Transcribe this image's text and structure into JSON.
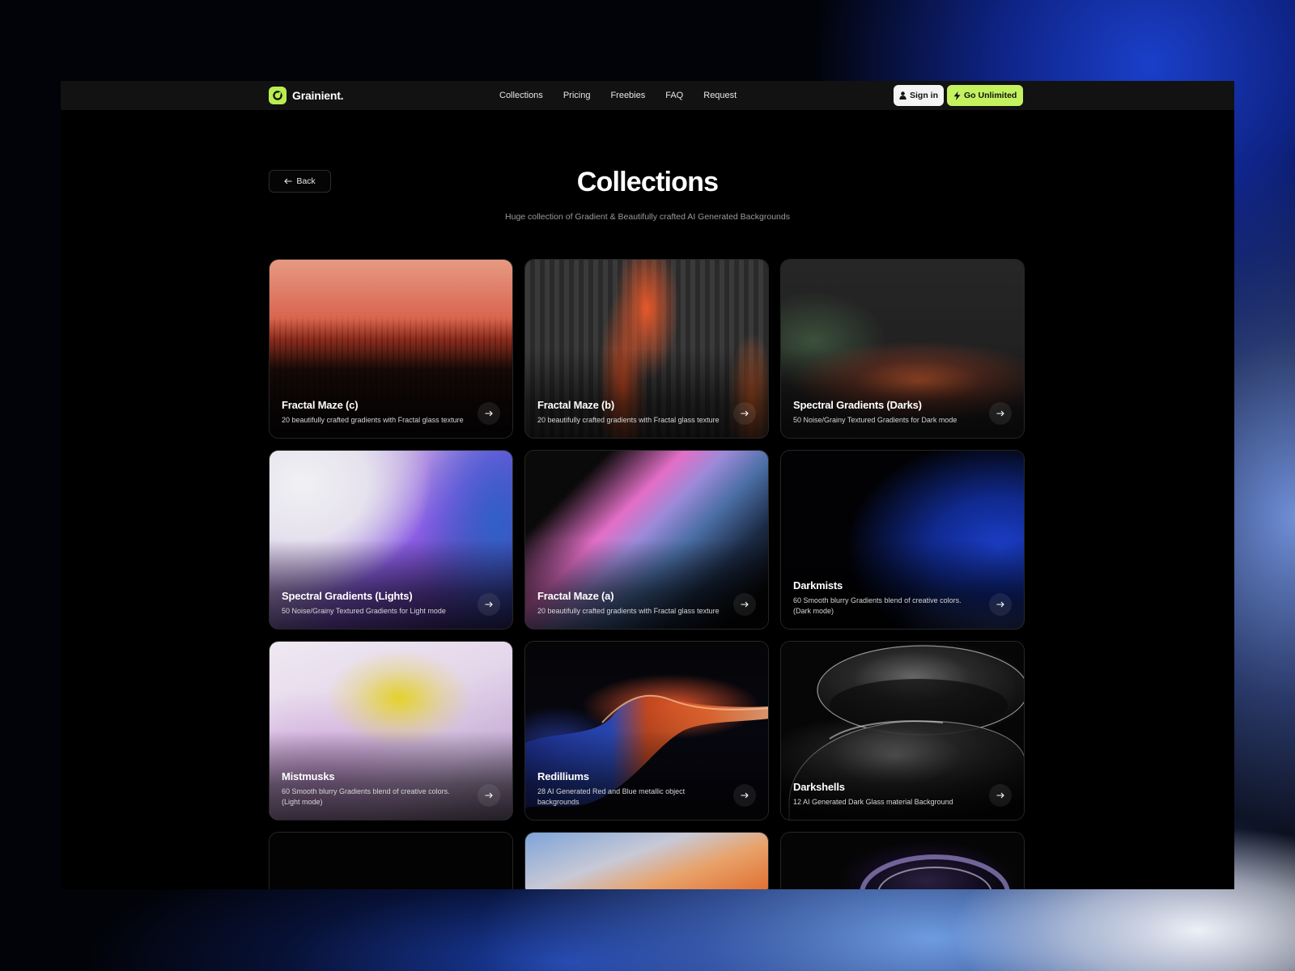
{
  "brand": {
    "name": "Grainient."
  },
  "nav": {
    "links": [
      "Collections",
      "Pricing",
      "Freebies",
      "FAQ",
      "Request"
    ],
    "signin_label": "Sign in",
    "unlimited_label": "Go Unlimited"
  },
  "back_label": "Back",
  "page": {
    "title": "Collections",
    "subtitle": "Huge collection of Gradient & Beautifully crafted AI Generated Backgrounds"
  },
  "cards": [
    {
      "title": "Fractal Maze (c)",
      "desc": "20 beautifully crafted gradients with Fractal glass texture"
    },
    {
      "title": "Fractal Maze (b)",
      "desc": "20 beautifully crafted gradients with Fractal glass texture"
    },
    {
      "title": "Spectral Gradients (Darks)",
      "desc": "50 Noise/Grainy Textured Gradients for Dark mode"
    },
    {
      "title": "Spectral Gradients (Lights)",
      "desc": "50 Noise/Grainy Textured Gradients for Light mode"
    },
    {
      "title": "Fractal Maze (a)",
      "desc": "20 beautifully crafted gradients with Fractal glass texture"
    },
    {
      "title": "Darkmists",
      "desc": "60 Smooth blurry Gradients blend of creative colors. (Dark mode)"
    },
    {
      "title": "Mistmusks",
      "desc": "60 Smooth blurry Gradients blend of creative colors. (Light mode)"
    },
    {
      "title": "Redilliums",
      "desc": "28 AI Generated Red and Blue metallic object backgrounds"
    },
    {
      "title": "Darkshells",
      "desc": "12 AI Generated Dark Glass material Background"
    }
  ],
  "colors": {
    "accent": "#c4f25e",
    "background": "#000000",
    "navbar": "#121212"
  },
  "icons": [
    "grainient-logo-icon",
    "user-icon",
    "bolt-icon",
    "arrow-left-icon",
    "arrow-right-icon"
  ]
}
